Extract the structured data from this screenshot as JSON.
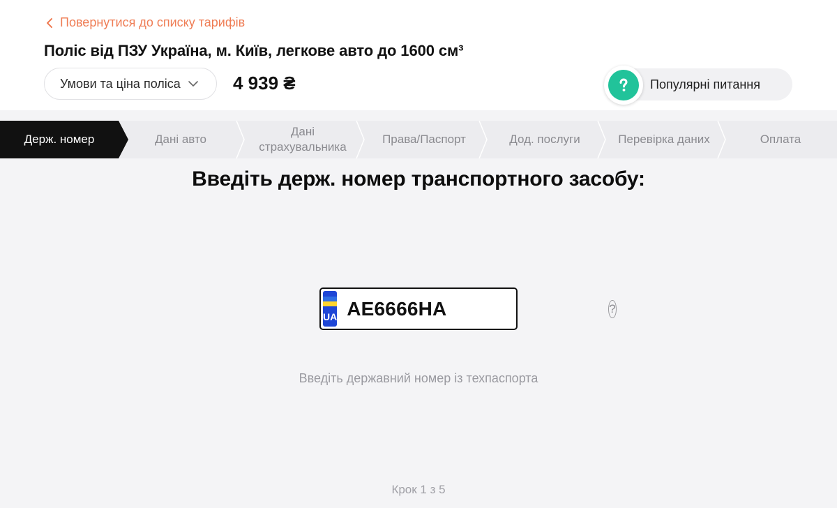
{
  "header": {
    "back_link": "Повернутися до списку тарифів",
    "title": "Поліс від ПЗУ Україна, м. Київ, легкове авто до 1600 см³",
    "terms_dropdown": "Умови та ціна поліса",
    "price": "4 939 ₴",
    "faq_button": "Популярні питання"
  },
  "stepper": {
    "steps": [
      {
        "label": "Держ. номер",
        "active": true
      },
      {
        "label": "Дані авто",
        "active": false
      },
      {
        "label": "Дані\nстрахувальника",
        "active": false
      },
      {
        "label": "Права/Паспорт",
        "active": false
      },
      {
        "label": "Дод. послуги",
        "active": false
      },
      {
        "label": "Перевірка даних",
        "active": false
      },
      {
        "label": "Оплата",
        "active": false
      }
    ]
  },
  "main": {
    "heading": "Введіть держ. номер транспортного засобу:",
    "plate": {
      "country_code": "UA",
      "value": "AE6666HA",
      "help": "?"
    },
    "hint": "Введіть державний номер із техпаспорта",
    "step_counter": "Крок 1 з 5"
  },
  "colors": {
    "accent": "#ef7d55",
    "faq_green": "#21c39a",
    "plate_blue": "#1e46d6",
    "active_step": "#111111"
  }
}
